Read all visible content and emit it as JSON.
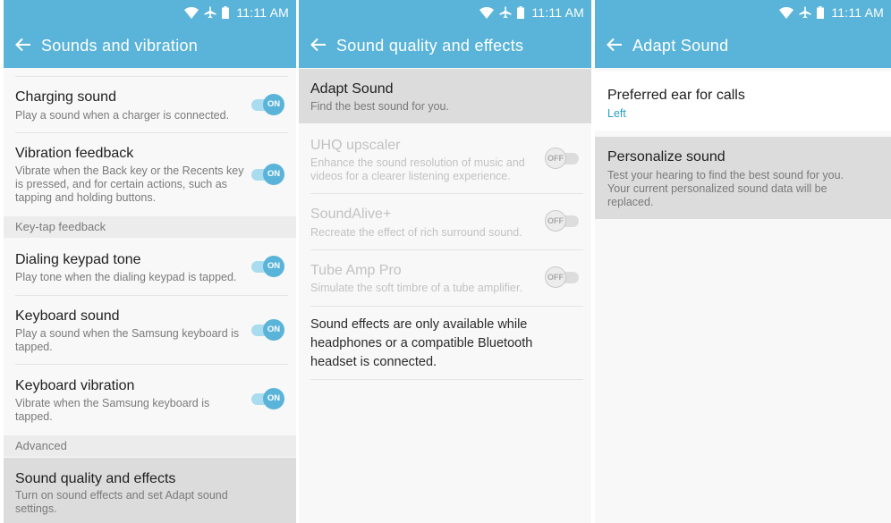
{
  "status_bar": {
    "time": "11:11 AM"
  },
  "panel1": {
    "title": "Sounds and vibration",
    "charging": {
      "title": "Charging sound",
      "desc": "Play a sound when a charger is connected.",
      "toggle": "ON"
    },
    "vibration": {
      "title": "Vibration feedback",
      "desc": "Vibrate when the Back key or the Recents key is pressed, and for certain actions, such as tapping and holding buttons.",
      "toggle": "ON"
    },
    "keytap_header": "Key-tap feedback",
    "dialing": {
      "title": "Dialing keypad tone",
      "desc": "Play tone when the dialing keypad is tapped.",
      "toggle": "ON"
    },
    "keyboard_sound": {
      "title": "Keyboard sound",
      "desc": "Play a sound when the Samsung keyboard is tapped.",
      "toggle": "ON"
    },
    "keyboard_vibration": {
      "title": "Keyboard vibration",
      "desc": "Vibrate when the Samsung keyboard is tapped.",
      "toggle": "ON"
    },
    "advanced_header": "Advanced",
    "sound_quality": {
      "title": "Sound quality and effects",
      "desc": "Turn on sound effects and set Adapt sound settings."
    }
  },
  "panel2": {
    "title": "Sound quality and effects",
    "adapt": {
      "title": "Adapt Sound",
      "desc": "Find the best sound for you."
    },
    "uhq": {
      "title": "UHQ upscaler",
      "desc": "Enhance the sound resolution of music and videos for a clearer listening experience.",
      "toggle": "OFF"
    },
    "soundalive": {
      "title": "SoundAlive+",
      "desc": "Recreate the effect of rich surround sound.",
      "toggle": "OFF"
    },
    "tubeamp": {
      "title": "Tube Amp Pro",
      "desc": "Simulate the soft timbre of a tube amplifier.",
      "toggle": "OFF"
    },
    "note": "Sound effects are only available while headphones or a compatible Bluetooth headset is connected."
  },
  "panel3": {
    "title": "Adapt Sound",
    "ear": {
      "title": "Preferred ear for calls",
      "value": "Left"
    },
    "personalize": {
      "title": "Personalize sound",
      "desc": "Test your hearing to find the best sound for you. Your current personalized sound data will be replaced."
    }
  },
  "colors": {
    "appbar": "#5ab4d9",
    "toggle_on": "#5ab4d9",
    "accent_text": "#2a9fc9",
    "selected_row": "#dcdcdc"
  },
  "icons": [
    "wifi-icon",
    "airplane-icon",
    "battery-icon",
    "back-arrow-icon"
  ]
}
